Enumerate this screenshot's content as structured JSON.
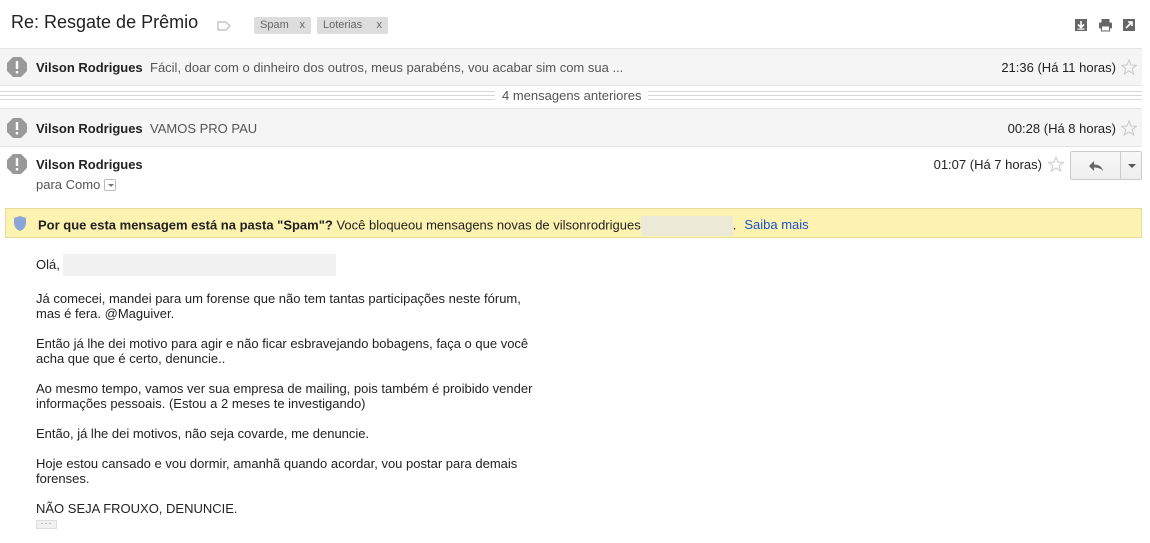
{
  "thread": {
    "subject": "Re: Resgate de Prêmio",
    "labels": [
      {
        "name": "Spam",
        "remove": "x"
      },
      {
        "name": "Loterias",
        "remove": "x"
      }
    ],
    "actions": {
      "download_icon": "download-icon",
      "print_icon": "print-icon",
      "popout_icon": "new-window-icon"
    }
  },
  "messages": [
    {
      "sender": "Vilson Rodrigues",
      "snippet": "Fácil, doar com o dinheiro dos outros, meus parabéns, vou acabar sim com sua ...",
      "time": "21:36 (Há 11 horas)"
    },
    {
      "sender": "Vilson Rodrigues",
      "snippet": "VAMOS PRO PAU",
      "time": "00:28 (Há 8 horas)"
    }
  ],
  "older_messages": "4 mensagens anteriores",
  "open_message": {
    "sender": "Vilson Rodrigues",
    "to": "para Como",
    "time": "01:07 (Há 7 horas)",
    "spam_notice": {
      "title": "Por que esta mensagem está na pasta \"Spam\"?",
      "text": " Você bloqueou mensagens novas de vilsonrodrigues",
      "suffix": ".",
      "link": "Saiba mais"
    },
    "greeting": "Olá,",
    "paragraphs": [
      "Já comecei, mandei para um forense que não tem tantas participações neste fórum,\nmas é fera. @Maguiver.",
      "Então já lhe dei motivo para agir e não ficar esbravejando bobagens, faça o que você\nacha que que é certo, denuncie..",
      "Ao mesmo tempo, vamos ver sua empresa de mailing, pois também é proibido vender\ninformações pessoais. (Estou a 2 meses te investigando)",
      "Então, já lhe dei motivos, não seja covarde, me denuncie.",
      "Hoje estou cansado e vou dormir, amanhã quando acordar, vou postar para demais\nforenses.",
      "NÃO SEJA FROUXO, DENUNCIE."
    ],
    "trimmed_content": "···"
  },
  "colors": {
    "banner_bg": "#fcf3b1",
    "link": "#1a4fcc",
    "warning_icon": "#999999"
  }
}
